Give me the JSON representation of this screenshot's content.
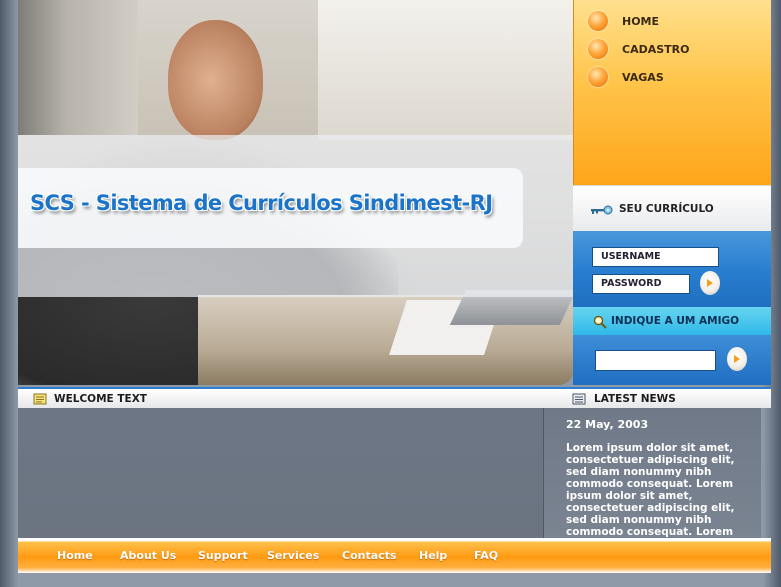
{
  "header": {
    "site_title": "SCS - Sistema de Currículos Sindimest-RJ"
  },
  "top_nav": {
    "items": [
      {
        "label": "HOME",
        "icon": "orange-ball-icon"
      },
      {
        "label": "CADASTRO",
        "icon": "orange-ball-icon"
      },
      {
        "label": "VAGAS",
        "icon": "orange-ball-icon"
      }
    ]
  },
  "curriculum": {
    "title": "SEU CURRÍCULO",
    "icon": "key-icon",
    "username_label": "USERNAME",
    "password_label": "PASSWORD"
  },
  "friend": {
    "title": "INDIQUE A UM AMIGO",
    "icon": "magnifier-icon",
    "input_value": ""
  },
  "sections": {
    "welcome_title": "WELCOME TEXT",
    "news_title": "LATEST NEWS"
  },
  "news": {
    "date": "22 May, 2003",
    "body": "Lorem ipsum dolor sit amet, consectetuer adipiscing elit, sed diam nonummy nibh commodo consequat. Lorem ipsum dolor sit amet, consectetuer adipiscing elit, sed diam nonummy nibh commodo consequat. Lorem"
  },
  "bottom_nav": {
    "items": [
      "Home",
      "About Us",
      "Support",
      "Services",
      "Contacts",
      "Help",
      "FAQ"
    ]
  },
  "colors": {
    "accent_orange": "#ffa51a",
    "accent_blue": "#2a7fd0",
    "title_blue": "#1c74c9",
    "content_gray": "#6c7685"
  }
}
